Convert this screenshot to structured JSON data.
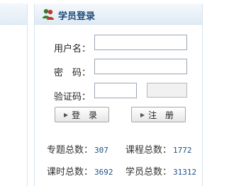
{
  "login": {
    "title": "学员登录",
    "username_label": "用户名：",
    "password_label": "密　码：",
    "captcha_label": "验证码：",
    "username_value": "",
    "password_value": "",
    "captcha_value": "",
    "login_button": "登 录",
    "register_button": "注 册",
    "icon": "users-icon"
  },
  "stats": {
    "topics_label": "专题总数：",
    "topics_value": "307",
    "courses_label": "课程总数：",
    "courses_value": "1772",
    "hours_label": "课时总数：",
    "hours_value": "3692",
    "students_label": "学员总数：",
    "students_value": "31312"
  },
  "colors": {
    "title": "#1e4a78",
    "header_bg": "#dfeaf4",
    "border": "#d6e3ee",
    "number": "#1f4f86"
  }
}
